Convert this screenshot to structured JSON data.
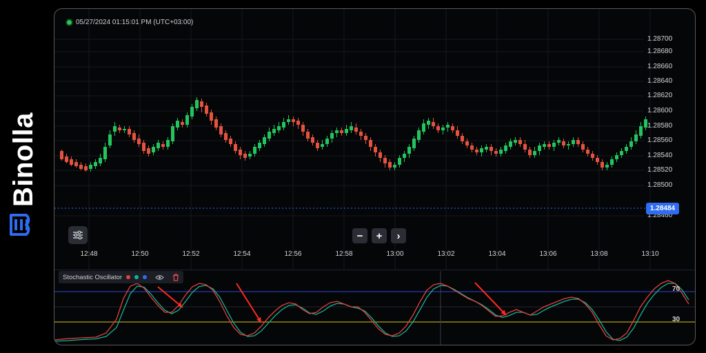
{
  "brand": {
    "name": "Binolla"
  },
  "header": {
    "timestamp": "05/27/2024  01:15:01 PM  (UTC+03:00)"
  },
  "price_axis": [
    "1.28700",
    "1.28680",
    "1.28660",
    "1.28640",
    "1.28620",
    "1.28600",
    "1.28580",
    "1.28560",
    "1.28540",
    "1.28520",
    "1.28500",
    "1.28460"
  ],
  "current_price": "1.28484",
  "time_axis": [
    "12:48",
    "12:50",
    "12:52",
    "12:54",
    "12:56",
    "12:58",
    "13:00",
    "13:02",
    "13:04",
    "13:06",
    "13:08",
    "13:10"
  ],
  "controls": {
    "zoom_out": "−",
    "zoom_in": "+",
    "next": "›"
  },
  "indicator": {
    "name": "Stochastic Oscillator",
    "series_colors": [
      "#e8413b",
      "#16b39a",
      "#2f6cf0"
    ],
    "upper_level": "70",
    "lower_level": "30",
    "upper_color": "#2f4bd6",
    "lower_color": "#d9c41a"
  },
  "colors": {
    "up": "#22c55e",
    "down": "#e5533f",
    "accent": "#2f6cf0"
  }
}
